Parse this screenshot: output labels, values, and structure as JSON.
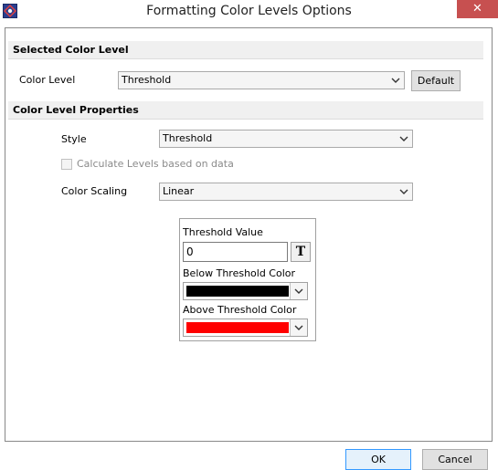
{
  "window": {
    "title": "Formatting Color Levels Options",
    "close_glyph": "✕"
  },
  "sections": {
    "selected_color_level": "Selected Color Level",
    "color_level_properties": "Color Level Properties"
  },
  "color_level": {
    "label": "Color Level",
    "value": "Threshold",
    "default_label": "Default"
  },
  "style": {
    "label": "Style",
    "value": "Threshold"
  },
  "calculate_levels": {
    "label": "Calculate Levels based on data",
    "checked": false,
    "enabled": false
  },
  "color_scaling": {
    "label": "Color Scaling",
    "value": "Linear"
  },
  "threshold": {
    "value_label": "Threshold Value",
    "value": "0",
    "t_button": "T",
    "below_label": "Below Threshold Color",
    "below_color": "#000000",
    "above_label": "Above Threshold Color",
    "above_color": "#ff0000"
  },
  "buttons": {
    "ok": "OK",
    "cancel": "Cancel"
  }
}
